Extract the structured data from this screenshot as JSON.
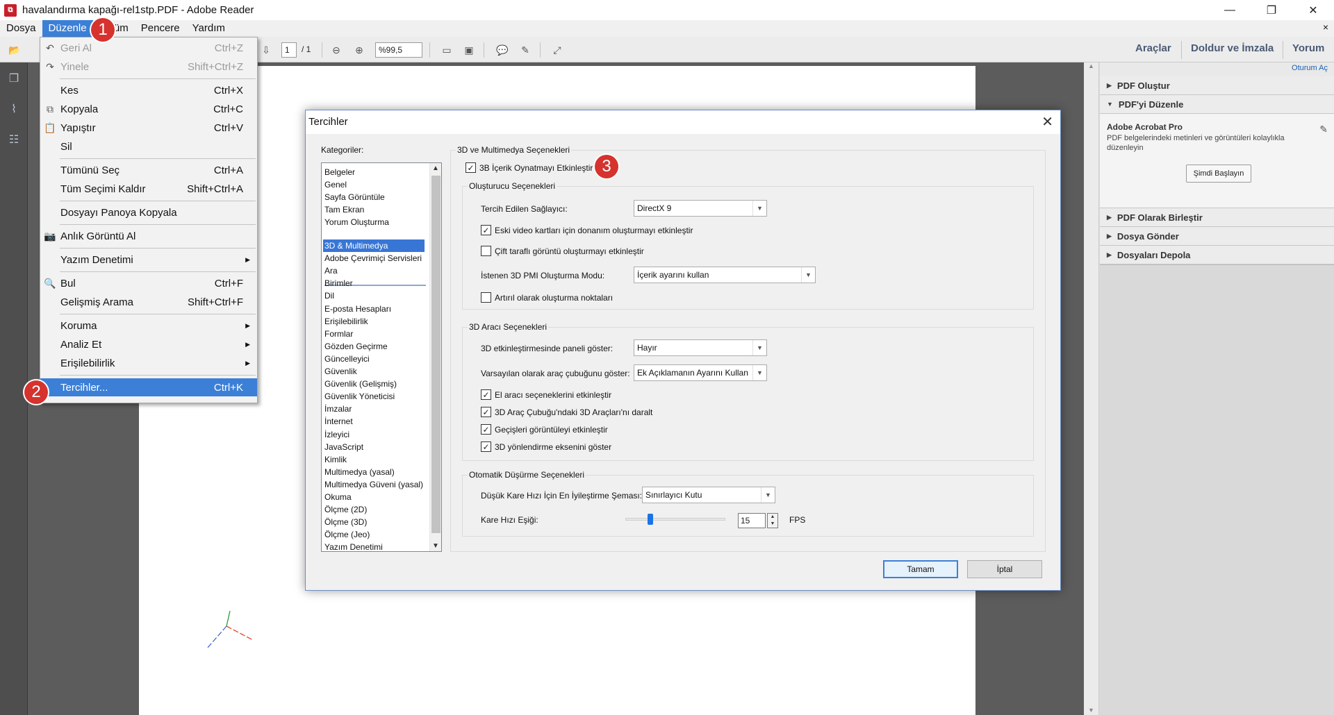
{
  "window": {
    "title": "havalandırma kapağı-rel1stp.PDF - Adobe Reader",
    "app_icon": "pdf-icon",
    "minimize": "—",
    "maximize": "❐",
    "close": "✕"
  },
  "menubar": {
    "items": [
      "Dosya",
      "Düzenle",
      "Görünüm",
      "Pencere",
      "Yardım"
    ],
    "visible_items": {
      "dosya": "Dosya",
      "duzenle": "Düzenle",
      "gorunum_tail": "nüm",
      "pencere": "Pencere",
      "yardim": "Yardım"
    },
    "close_doc": "×"
  },
  "toolbar": {
    "open_label": "Aç",
    "page_current": "1",
    "page_total": "/ 1",
    "zoom": "%99,5",
    "right": {
      "tools": "Araçlar",
      "fill_sign": "Doldur ve İmzala",
      "comment": "Yorum"
    }
  },
  "edit_menu": {
    "items": [
      {
        "label": "Geri Al",
        "shortcut": "Ctrl+Z",
        "disabled": true
      },
      {
        "label": "Yinele",
        "shortcut": "Shift+Ctrl+Z",
        "disabled": true
      },
      {
        "label": "Kes",
        "shortcut": "Ctrl+X"
      },
      {
        "label": "Kopyala",
        "shortcut": "Ctrl+C"
      },
      {
        "label": "Yapıştır",
        "shortcut": "Ctrl+V"
      },
      {
        "label": "Sil",
        "shortcut": ""
      },
      {
        "label": "Tümünü Seç",
        "shortcut": "Ctrl+A"
      },
      {
        "label": "Tüm Seçimi Kaldır",
        "shortcut": "Shift+Ctrl+A"
      },
      {
        "label": "Dosyayı Panoya Kopyala",
        "shortcut": ""
      },
      {
        "label": "Anlık Görüntü Al",
        "shortcut": ""
      },
      {
        "label": "Yazım Denetimi",
        "shortcut": ""
      },
      {
        "label": "Bul",
        "shortcut": "Ctrl+F"
      },
      {
        "label": "Gelişmiş Arama",
        "shortcut": "Shift+Ctrl+F"
      },
      {
        "label": "Koruma",
        "shortcut": ""
      },
      {
        "label": "Analiz Et",
        "shortcut": ""
      },
      {
        "label": "Erişilebilirlik",
        "shortcut": ""
      },
      {
        "label": "Tercihler...",
        "shortcut": "Ctrl+K"
      }
    ]
  },
  "badges": {
    "one": "1",
    "two": "2",
    "three": "3"
  },
  "right_pane": {
    "sign_in": "Oturum Aç",
    "sections": [
      "PDF Oluştur",
      "PDF'yi Düzenle",
      "PDF Olarak Birleştir",
      "Dosya Gönder",
      "Dosyaları Depola"
    ],
    "promo_title": "Adobe Acrobat Pro",
    "promo_desc": "PDF belgelerindeki metinleri ve görüntüleri kolaylıkla düzenleyin",
    "promo_button": "Şimdi Başlayın"
  },
  "dialog": {
    "title": "Tercihler",
    "categories_label": "Kategoriler:",
    "categories_top": [
      "Belgeler",
      "Genel",
      "Sayfa Görüntüle",
      "Tam Ekran",
      "Yorum Oluşturma"
    ],
    "categories": [
      "3D & Multimedya",
      "Adobe Çevrimiçi Servisleri",
      "Ara",
      "Birimler",
      "Dil",
      "E-posta Hesapları",
      "Erişilebilirlik",
      "Formlar",
      "Gözden Geçirme",
      "Güncelleyici",
      "Güvenlik",
      "Güvenlik (Gelişmiş)",
      "Güvenlik Yöneticisi",
      "İmzalar",
      "İnternet",
      "İzleyici",
      "JavaScript",
      "Kimlik",
      "Multimedya (yasal)",
      "Multimedya Güveni (yasal)",
      "Okuma",
      "Ölçme (2D)",
      "Ölçme (3D)",
      "Ölçme (Jeo)",
      "Yazım Denetimi"
    ],
    "selected_category": "3D & Multimedya",
    "main_group": "3D ve Multimedya Seçenekleri",
    "enable_3d": {
      "label": "3B İçerik Oynatmayı Etkinleştir",
      "checked": true
    },
    "renderer_group": "Oluşturucu Seçenekleri",
    "preferred_renderer": {
      "label": "Tercih Edilen Sağlayıcı:",
      "value": "DirectX 9"
    },
    "legacy_video": {
      "label": "Eski video kartları için donanım oluşturmayı etkinleştir",
      "checked": true
    },
    "double_sided": {
      "label": "Çift taraflı görüntü oluşturmayı etkinleştir",
      "checked": false
    },
    "pmi_mode": {
      "label": "İstenen 3D PMI Oluşturma Modu:",
      "value": "İçerik ayarını kullan"
    },
    "incremental": {
      "label": "Artırıl olarak oluşturma noktaları",
      "checked": false
    },
    "tool_group": "3D Aracı Seçenekleri",
    "show_panel": {
      "label": "3D etkinleştirmesinde paneli göster:",
      "value": "Hayır"
    },
    "default_toolbar": {
      "label": "Varsayılan olarak araç çubuğunu göster:",
      "value": "Ek Açıklamanın Ayarını Kullan"
    },
    "hand_tool": {
      "label": "El aracı seçeneklerini etkinleştir",
      "checked": true
    },
    "collapse_tools": {
      "label": "3D Araç Çubuğu'ndaki 3D Araçları'nı daralt",
      "checked": true
    },
    "transitions": {
      "label": "Geçişleri görüntüleyi etkinleştir",
      "checked": true
    },
    "orientation_axis": {
      "label": "3D yönlendirme eksenini göster",
      "checked": true
    },
    "degrade_group": "Otomatik Düşürme Seçenekleri",
    "optimization": {
      "label": "Düşük Kare Hızı İçin En İyileştirme Şeması:",
      "value": "Sınırlayıcı Kutu"
    },
    "framerate": {
      "label": "Kare Hızı Eşiği:",
      "value": "15",
      "unit": "FPS",
      "slider_fraction": 0.25
    },
    "ok": "Tamam",
    "cancel": "İptal"
  }
}
